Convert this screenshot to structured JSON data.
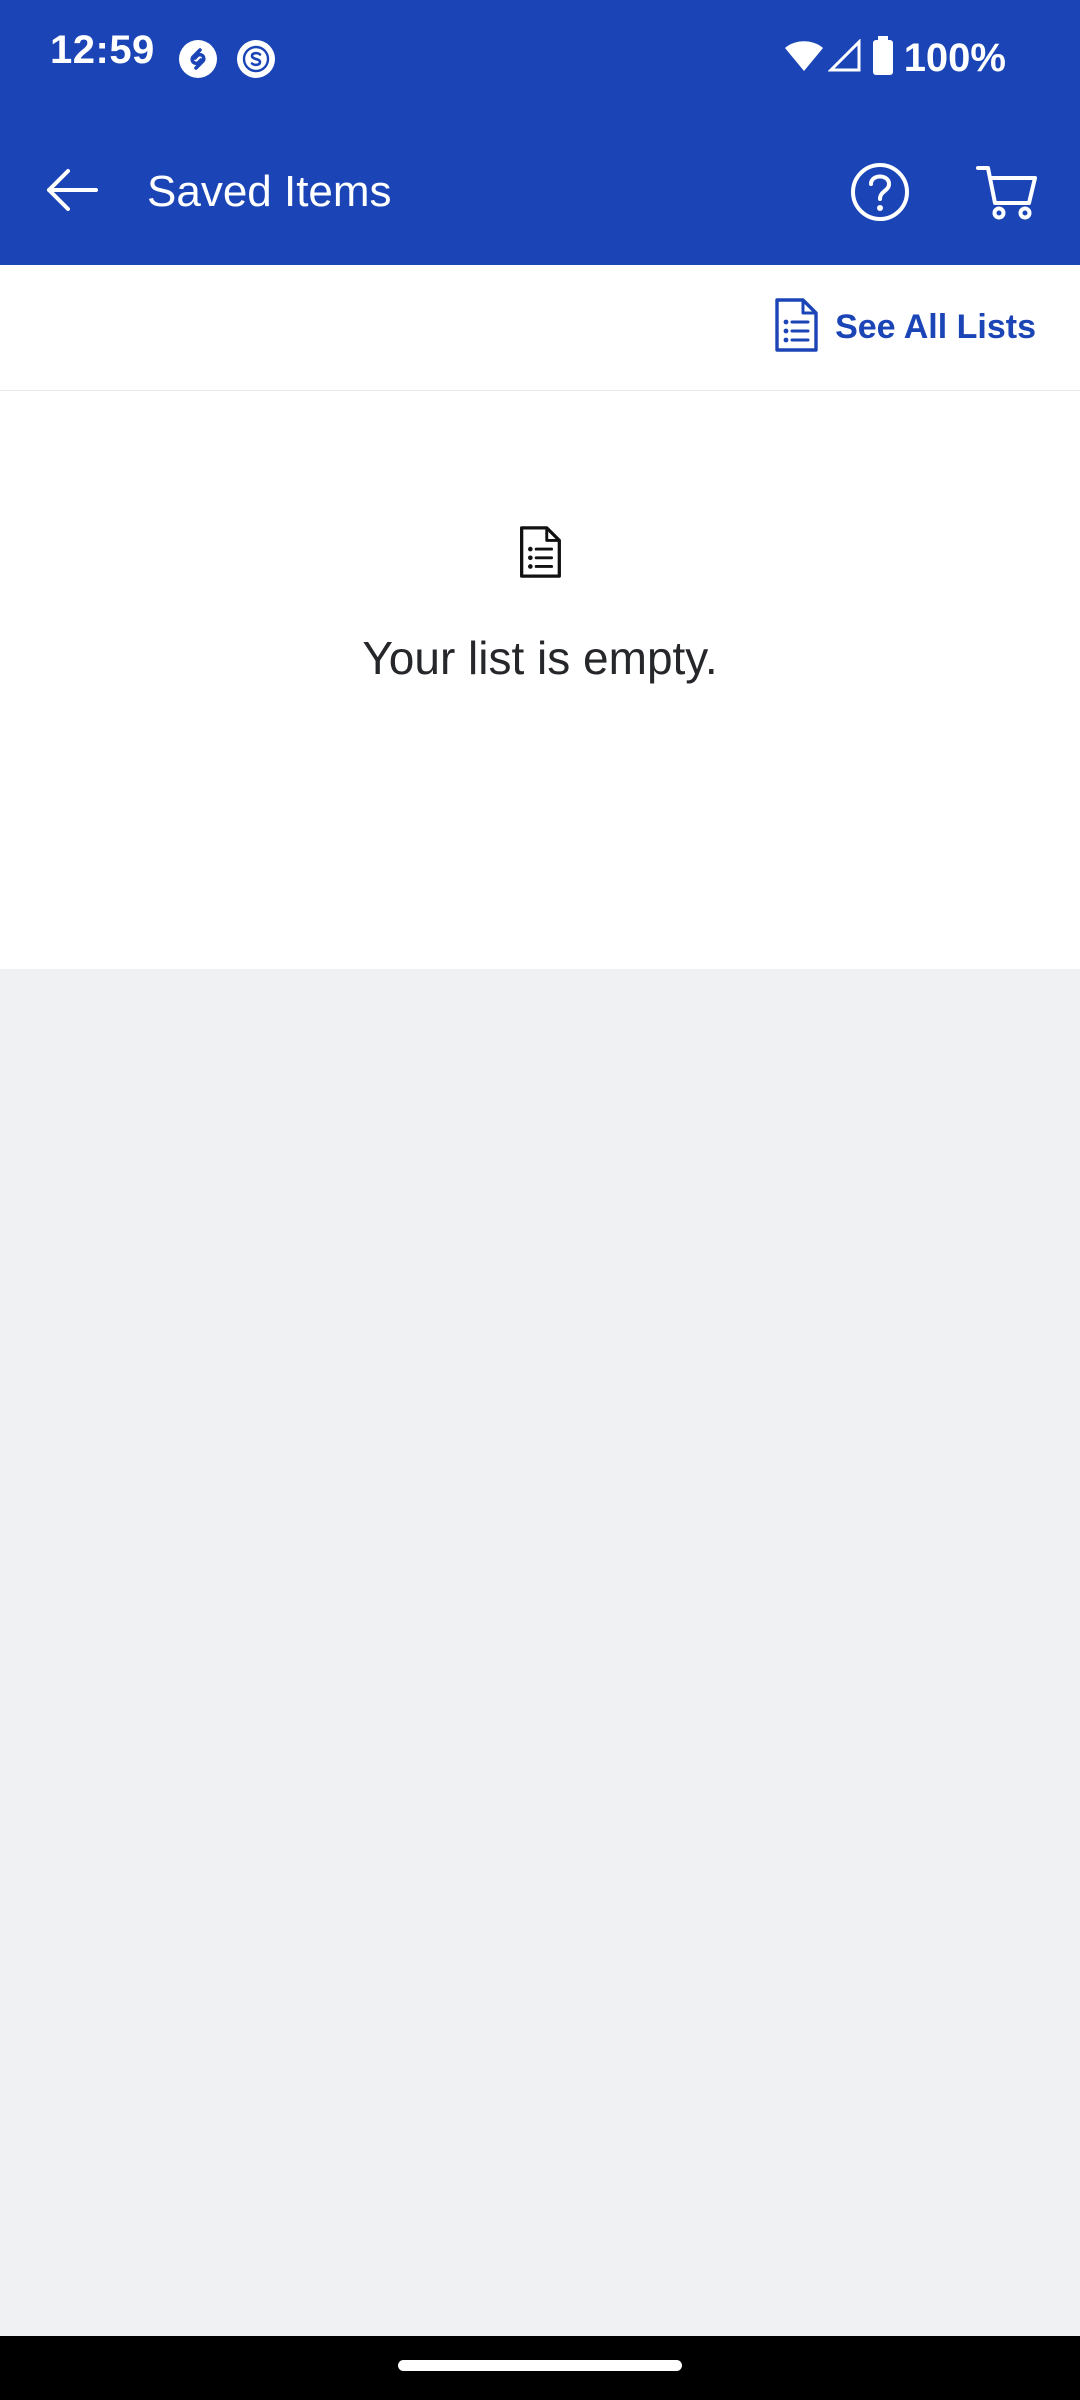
{
  "status_bar": {
    "time": "12:59",
    "battery": "100%",
    "icons": [
      "shazam-icon",
      "s-app-icon",
      "wifi-icon",
      "cell-signal-icon",
      "battery-icon"
    ]
  },
  "app_bar": {
    "title": "Saved Items",
    "icons": [
      "arrow-left-icon",
      "help-circle-icon",
      "cart-icon"
    ],
    "color": "#1b45b7"
  },
  "toolbar": {
    "see_all_label": "See All Lists",
    "icon": "list-document-icon"
  },
  "empty_state": {
    "icon": "list-document-icon",
    "message": "Your list is empty."
  },
  "colors": {
    "brand_blue": "#1b45b7",
    "page_background": "#f0f1f3",
    "text_dark": "#25272b"
  }
}
